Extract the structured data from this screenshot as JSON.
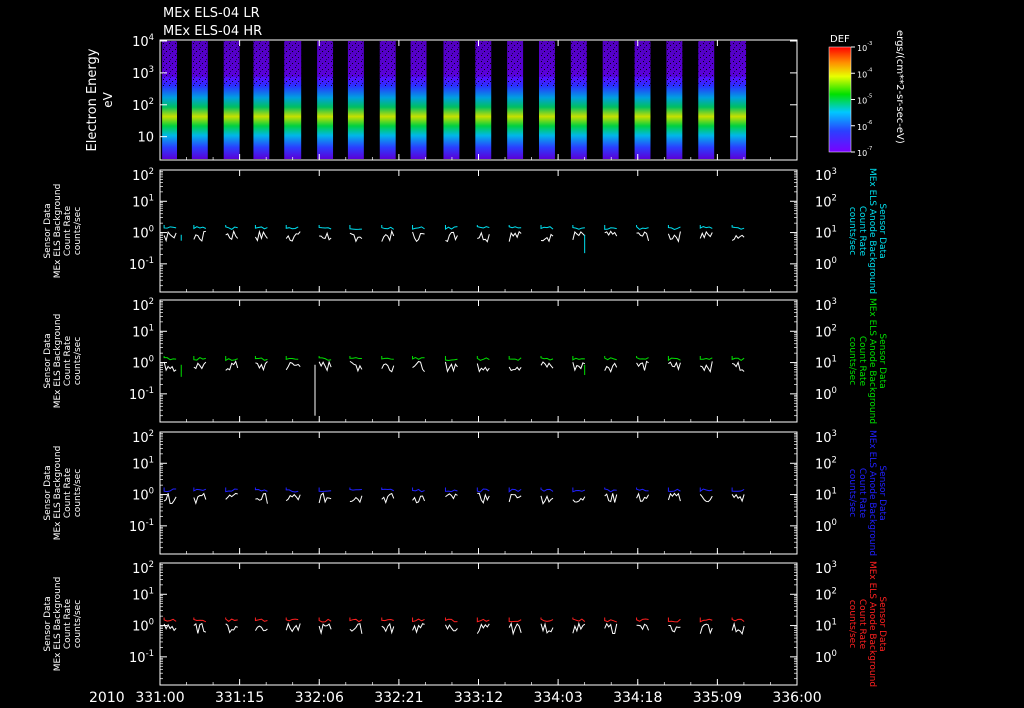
{
  "titles": [
    "MEx ELS-04 LR",
    "MEx ELS-04 HR"
  ],
  "colors": {
    "background": "#000000",
    "axes": "#ffffff",
    "trace_main": "#ffffff",
    "panel_accents": [
      "#00e0f0",
      "#00e000",
      "#2020ff",
      "#ff2020"
    ]
  },
  "x_axis": {
    "year_label": "2010",
    "tick_labels": [
      "331:00",
      "331:15",
      "332:06",
      "332:21",
      "333:12",
      "334:03",
      "334:18",
      "335:09",
      "336:00"
    ],
    "range_hours": [
      0,
      120
    ],
    "major_tick_step_hours": 15
  },
  "spectrogram": {
    "ylabel_1": "Electron Energy",
    "ylabel_2": "eV",
    "y_ticks": [
      {
        "base": "10",
        "exp": "4"
      },
      {
        "base": "10",
        "exp": "3"
      },
      {
        "base": "10",
        "exp": "2"
      },
      {
        "base": "10",
        "exp": ""
      }
    ],
    "log_range": [
      0.3,
      4
    ],
    "colorbar": {
      "title": "DEF",
      "unit_label": "ergs/(cm**2-sr-sec-eV)",
      "ticks": [
        {
          "base": "10",
          "exp": "-3"
        },
        {
          "base": "10",
          "exp": "-4"
        },
        {
          "base": "10",
          "exp": "-5"
        },
        {
          "base": "10",
          "exp": "-6"
        },
        {
          "base": "10",
          "exp": "-7"
        }
      ]
    },
    "observation_intervals_hours": [
      [
        0.4,
        3.2
      ],
      [
        6,
        9
      ],
      [
        12,
        15
      ],
      [
        17.6,
        20.6
      ],
      [
        23.4,
        26.6
      ],
      [
        29.6,
        32.6
      ],
      [
        35.4,
        38.4
      ],
      [
        41.4,
        44.4
      ],
      [
        47.2,
        50.2
      ],
      [
        53.4,
        56.4
      ],
      [
        59.4,
        62.4
      ],
      [
        65.4,
        68.4
      ],
      [
        71.4,
        74.4
      ],
      [
        77.4,
        80.4
      ],
      [
        83.4,
        86.4
      ],
      [
        89.4,
        92.4
      ],
      [
        95.4,
        98.4
      ],
      [
        101.4,
        104.4
      ],
      [
        107.4,
        110.4
      ]
    ]
  },
  "line_panels": [
    {
      "left_label": [
        "Sensor Data",
        "MEx ELS Background",
        "Count Rate",
        "counts/sec"
      ],
      "right_label": [
        "Sensor Data",
        "MEx ELS Anode Background",
        "Count Rate",
        "counts/sec"
      ],
      "left_ticks": [
        {
          "base": "10",
          "exp": "2"
        },
        {
          "base": "10",
          "exp": "1"
        },
        {
          "base": "10",
          "exp": "0"
        },
        {
          "base": "10",
          "exp": "-1"
        }
      ],
      "right_ticks": [
        {
          "base": "10",
          "exp": "3"
        },
        {
          "base": "10",
          "exp": "2"
        },
        {
          "base": "10",
          "exp": "1"
        },
        {
          "base": "10",
          "exp": "0"
        }
      ],
      "left_log_range": [
        -1.9,
        2
      ],
      "right_log_range": [
        -0.9,
        3
      ],
      "accent_level": 1.4,
      "main_level": 0.85,
      "dips": [
        {
          "hour": 4,
          "value": 0.55
        },
        {
          "hour": 80,
          "value": 0.22
        }
      ]
    },
    {
      "left_label": [
        "Sensor Data",
        "MEx ELS Background",
        "Count Rate",
        "counts/sec"
      ],
      "right_label": [
        "Sensor Data",
        "MEx ELS Anode Background",
        "Count Rate",
        "counts/sec"
      ],
      "left_ticks": [
        {
          "base": "10",
          "exp": "2"
        },
        {
          "base": "10",
          "exp": "1"
        },
        {
          "base": "10",
          "exp": "0"
        },
        {
          "base": "10",
          "exp": "-1"
        }
      ],
      "right_ticks": [
        {
          "base": "10",
          "exp": "3"
        },
        {
          "base": "10",
          "exp": "2"
        },
        {
          "base": "10",
          "exp": "1"
        },
        {
          "base": "10",
          "exp": "0"
        }
      ],
      "left_log_range": [
        -1.9,
        2
      ],
      "right_log_range": [
        -0.9,
        3
      ],
      "accent_level": 1.3,
      "main_level": 0.85,
      "dips": [
        {
          "hour": 4,
          "value": 0.35
        },
        {
          "hour": 29.2,
          "value": 0.02
        },
        {
          "hour": 80,
          "value": 0.4
        }
      ]
    },
    {
      "left_label": [
        "Sensor Data",
        "MEx ELS Background",
        "Count Rate",
        "counts/sec"
      ],
      "right_label": [
        "Sensor Data",
        "MEx ELS Anode Background",
        "Count Rate",
        "counts/sec"
      ],
      "left_ticks": [
        {
          "base": "10",
          "exp": "2"
        },
        {
          "base": "10",
          "exp": "1"
        },
        {
          "base": "10",
          "exp": "0"
        },
        {
          "base": "10",
          "exp": "-1"
        }
      ],
      "right_ticks": [
        {
          "base": "10",
          "exp": "3"
        },
        {
          "base": "10",
          "exp": "2"
        },
        {
          "base": "10",
          "exp": "1"
        },
        {
          "base": "10",
          "exp": "0"
        }
      ],
      "left_log_range": [
        -1.9,
        2
      ],
      "right_log_range": [
        -0.9,
        3
      ],
      "accent_level": 1.35,
      "main_level": 0.85,
      "dips": []
    },
    {
      "left_label": [
        "Sensor Data",
        "MEx ELS Background",
        "Count Rate",
        "counts/sec"
      ],
      "right_label": [
        "Sensor Data",
        "MEx ELS Anode Background",
        "Count Rate",
        "counts/sec"
      ],
      "left_ticks": [
        {
          "base": "10",
          "exp": "2"
        },
        {
          "base": "10",
          "exp": "1"
        },
        {
          "base": "10",
          "exp": "0"
        },
        {
          "base": "10",
          "exp": "-1"
        }
      ],
      "right_ticks": [
        {
          "base": "10",
          "exp": "3"
        },
        {
          "base": "10",
          "exp": "2"
        },
        {
          "base": "10",
          "exp": "1"
        },
        {
          "base": "10",
          "exp": "0"
        }
      ],
      "left_log_range": [
        -1.9,
        2
      ],
      "right_log_range": [
        -0.9,
        3
      ],
      "accent_level": 1.45,
      "main_level": 0.9,
      "dips": []
    }
  ],
  "chart_data": {
    "type": "line",
    "title": "MEx ELS-04 LR / MEx ELS-04 HR",
    "x_range_hours": [
      0,
      120
    ],
    "x_tick_labels": [
      "331:00",
      "331:15",
      "332:06",
      "332:21",
      "333:12",
      "334:03",
      "334:18",
      "335:09",
      "336:00"
    ],
    "panels": [
      {
        "type": "heatmap",
        "ylabel": "Electron Energy eV",
        "ylim_log10": [
          0.3,
          4
        ],
        "colorbar_label": "DEF ergs/(cm**2-sr-sec-eV)",
        "colorbar_log10_range": [
          -7,
          -3
        ]
      },
      {
        "type": "line",
        "ylabel": "Sensor Data MEx ELS Background Count Rate counts/sec",
        "ylim_log10": [
          -1.9,
          2
        ],
        "typical_value": 0.85,
        "upper_trace_value": 1.4
      },
      {
        "type": "line",
        "ylabel": "Sensor Data MEx ELS Background Count Rate counts/sec",
        "ylim_log10": [
          -1.9,
          2
        ],
        "typical_value": 0.85,
        "upper_trace_value": 1.3
      },
      {
        "type": "line",
        "ylabel": "Sensor Data MEx ELS Background Count Rate counts/sec",
        "ylim_log10": [
          -1.9,
          2
        ],
        "typical_value": 0.85,
        "upper_trace_value": 1.35
      },
      {
        "type": "line",
        "ylabel": "Sensor Data MEx ELS Background Count Rate counts/sec",
        "ylim_log10": [
          -1.9,
          2
        ],
        "typical_value": 0.9,
        "upper_trace_value": 1.45
      }
    ]
  }
}
